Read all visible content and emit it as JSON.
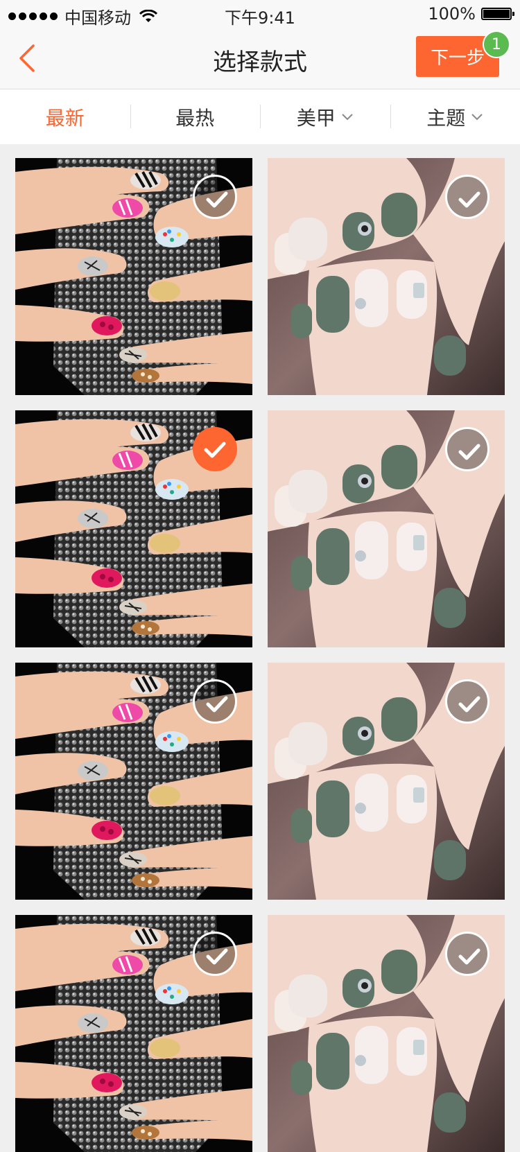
{
  "status_bar": {
    "carrier": "中国移动",
    "time": "下午9:41",
    "battery": "100%",
    "battery_level": 1.0
  },
  "nav": {
    "back_icon": "chevron-left-icon",
    "title": "选择款式",
    "next_label": "下一步",
    "badge_count": "1"
  },
  "tabs": [
    {
      "label": "最新",
      "active": true
    },
    {
      "label": "最热",
      "active": false
    },
    {
      "label": "美甲",
      "active": false,
      "dropdown": true
    },
    {
      "label": "主题",
      "active": false,
      "dropdown": true
    }
  ],
  "grid": {
    "items": [
      {
        "image": "nail-photo-colorful",
        "selected": false
      },
      {
        "image": "nail-photo-green-white",
        "selected": false
      },
      {
        "image": "nail-photo-colorful",
        "selected": true
      },
      {
        "image": "nail-photo-green-white",
        "selected": false
      },
      {
        "image": "nail-photo-colorful",
        "selected": false
      },
      {
        "image": "nail-photo-green-white",
        "selected": false
      },
      {
        "image": "nail-photo-colorful",
        "selected": false
      },
      {
        "image": "nail-photo-green-white",
        "selected": false
      }
    ]
  },
  "colors": {
    "accent": "#fd6630",
    "badge": "#5cbb50",
    "background": "#efefef"
  }
}
